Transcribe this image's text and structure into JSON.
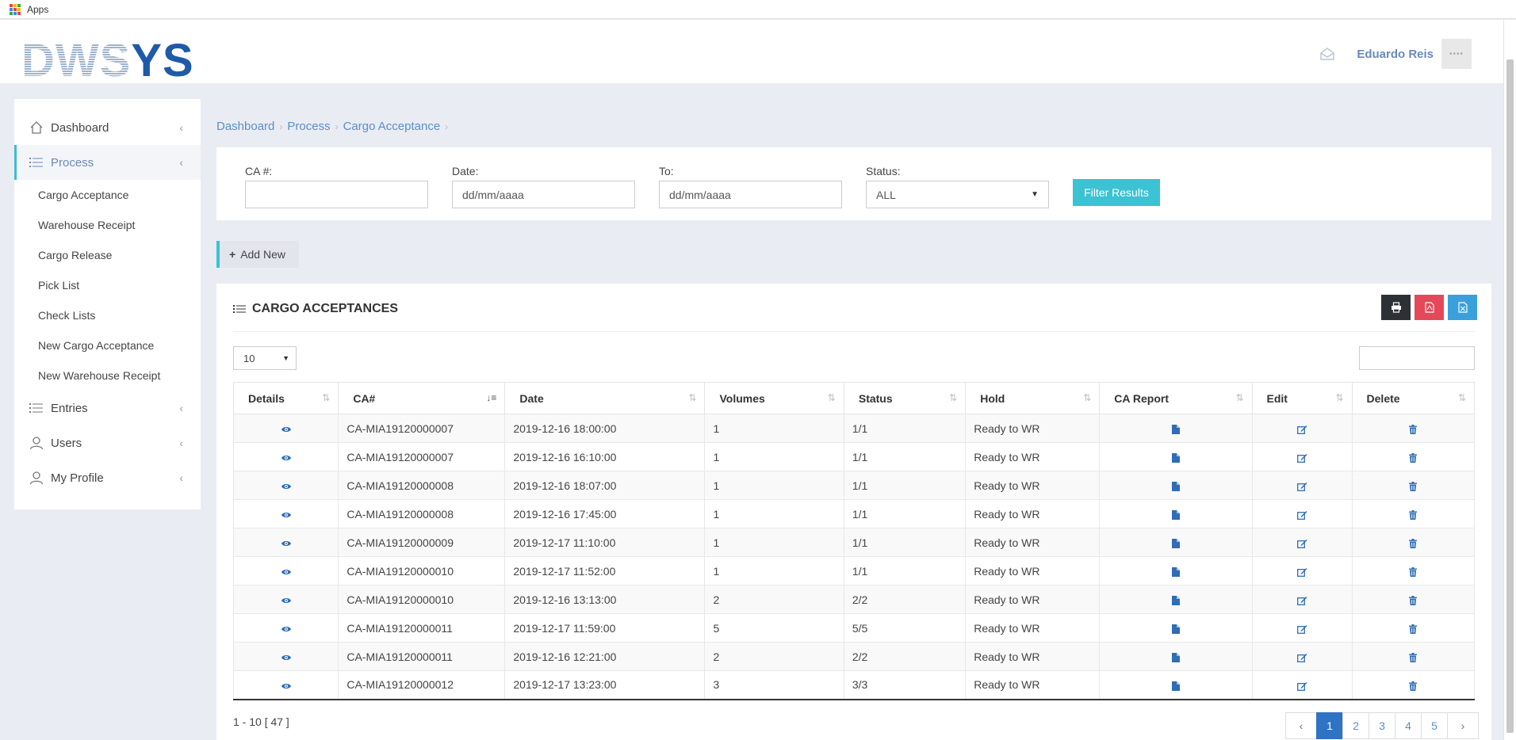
{
  "browser": {
    "bookmarks_label": "Apps"
  },
  "header": {
    "logo_part1": "DWS",
    "logo_part2": "YS",
    "user_name": "Eduardo Reis",
    "avatar_text": "••••"
  },
  "sidebar": {
    "dashboard": "Dashboard",
    "process": "Process",
    "process_items": [
      "Cargo Acceptance",
      "Warehouse Receipt",
      "Cargo Release",
      "Pick List",
      "Check Lists",
      "New Cargo Acceptance",
      "New Warehouse Receipt"
    ],
    "entries": "Entries",
    "users": "Users",
    "my_profile": "My Profile"
  },
  "breadcrumb": [
    "Dashboard",
    "Process",
    "Cargo Acceptance"
  ],
  "filters": {
    "ca_label": "CA #:",
    "ca_value": "",
    "date_label": "Date:",
    "date_value": "dd/mm/aaaa",
    "to_label": "To:",
    "to_value": "dd/mm/aaaa",
    "status_label": "Status:",
    "status_value": "ALL",
    "button": "Filter Results"
  },
  "add_new": "Add New",
  "table": {
    "title": "CARGO ACCEPTANCES",
    "page_size": "10",
    "columns": [
      "Details",
      "CA#",
      "Date",
      "Volumes",
      "Status",
      "Hold",
      "CA Report",
      "Edit",
      "Delete"
    ],
    "rows": [
      {
        "ca": "CA-MIA19120000007",
        "date": "2019-12-16 18:00:00",
        "volumes": "1",
        "status": "1/1",
        "hold": "Ready to WR"
      },
      {
        "ca": "CA-MIA19120000007",
        "date": "2019-12-16 16:10:00",
        "volumes": "1",
        "status": "1/1",
        "hold": "Ready to WR"
      },
      {
        "ca": "CA-MIA19120000008",
        "date": "2019-12-16 18:07:00",
        "volumes": "1",
        "status": "1/1",
        "hold": "Ready to WR"
      },
      {
        "ca": "CA-MIA19120000008",
        "date": "2019-12-16 17:45:00",
        "volumes": "1",
        "status": "1/1",
        "hold": "Ready to WR"
      },
      {
        "ca": "CA-MIA19120000009",
        "date": "2019-12-17 11:10:00",
        "volumes": "1",
        "status": "1/1",
        "hold": "Ready to WR"
      },
      {
        "ca": "CA-MIA19120000010",
        "date": "2019-12-17 11:52:00",
        "volumes": "1",
        "status": "1/1",
        "hold": "Ready to WR"
      },
      {
        "ca": "CA-MIA19120000010",
        "date": "2019-12-16 13:13:00",
        "volumes": "2",
        "status": "2/2",
        "hold": "Ready to WR"
      },
      {
        "ca": "CA-MIA19120000011",
        "date": "2019-12-17 11:59:00",
        "volumes": "5",
        "status": "5/5",
        "hold": "Ready to WR"
      },
      {
        "ca": "CA-MIA19120000011",
        "date": "2019-12-16 12:21:00",
        "volumes": "2",
        "status": "2/2",
        "hold": "Ready to WR"
      },
      {
        "ca": "CA-MIA19120000012",
        "date": "2019-12-17 13:23:00",
        "volumes": "3",
        "status": "3/3",
        "hold": "Ready to WR"
      }
    ],
    "summary": "1 - 10 [ 47 ]",
    "pages": [
      "1",
      "2",
      "3",
      "4",
      "5"
    ],
    "active_page": "1"
  },
  "colors": {
    "accent": "#3bc2d3",
    "link": "#5c8ec4",
    "primary": "#2f73c4",
    "icon": "#2f6db5"
  }
}
